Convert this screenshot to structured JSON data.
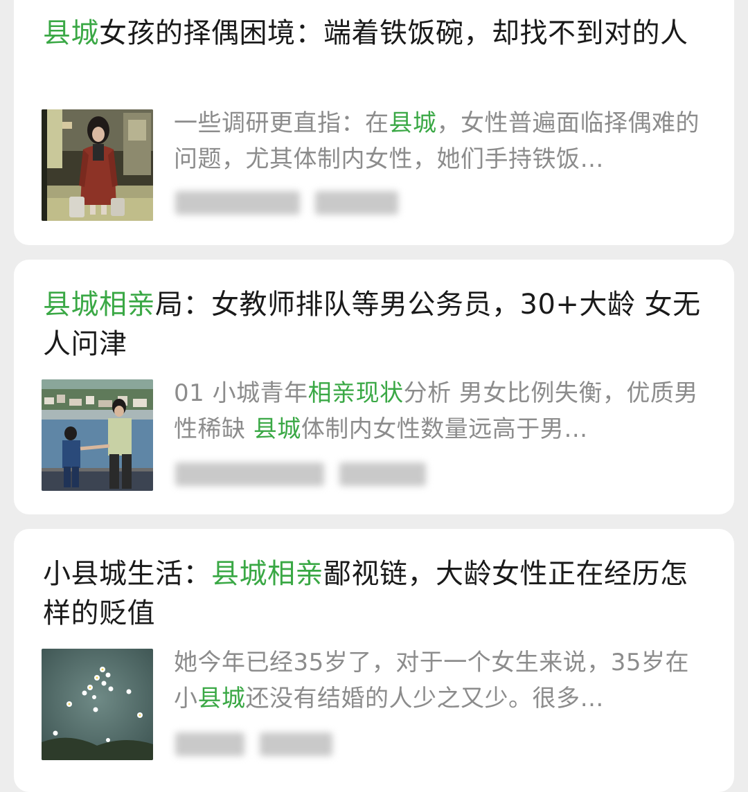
{
  "articles": [
    {
      "title_parts": [
        {
          "text": "县城",
          "hl": true
        },
        {
          "text": "女孩的择偶困境：端着铁饭碗，却找不到对的人",
          "hl": false
        }
      ],
      "snippet_parts": [
        {
          "text": "一些调研更直指：在",
          "hl": false
        },
        {
          "text": "县城",
          "hl": true
        },
        {
          "text": "，女性普遍面临择偶难的问题，尤其体制内女性，她们手持铁饭…",
          "hl": false
        }
      ],
      "thumbnail": "woman-in-red-coat-at-station"
    },
    {
      "title_parts": [
        {
          "text": "县城相亲",
          "hl": true
        },
        {
          "text": "局：女教师排队等男公务员，30+大龄 女无人问津",
          "hl": false
        }
      ],
      "snippet_parts": [
        {
          "text": "01 小城青年",
          "hl": false
        },
        {
          "text": "相亲现状",
          "hl": true
        },
        {
          "text": "分析 男女比例失衡，优质男性稀缺 ",
          "hl": false
        },
        {
          "text": "县城",
          "hl": true
        },
        {
          "text": "体制内女性数量远高于男…",
          "hl": false
        }
      ],
      "thumbnail": "couple-holding-hands-by-harbor"
    },
    {
      "title_parts": [
        {
          "text": "小县城生活：",
          "hl": false
        },
        {
          "text": "县城相亲",
          "hl": true
        },
        {
          "text": "鄙视链，大龄女性正在经历怎样的贬值",
          "hl": false
        }
      ],
      "snippet_parts": [
        {
          "text": "她今年已经35岁了，对于一个女生来说，35岁在小",
          "hl": false
        },
        {
          "text": "县城",
          "hl": true
        },
        {
          "text": "还没有结婚的人少之又少。很多…",
          "hl": false
        }
      ],
      "thumbnail": "white-flowers-on-water"
    }
  ],
  "colors": {
    "highlight": "#3aa845",
    "title": "#1a1a1a",
    "snippet": "#8c8c8c",
    "card": "#ffffff",
    "background": "#ededed"
  }
}
